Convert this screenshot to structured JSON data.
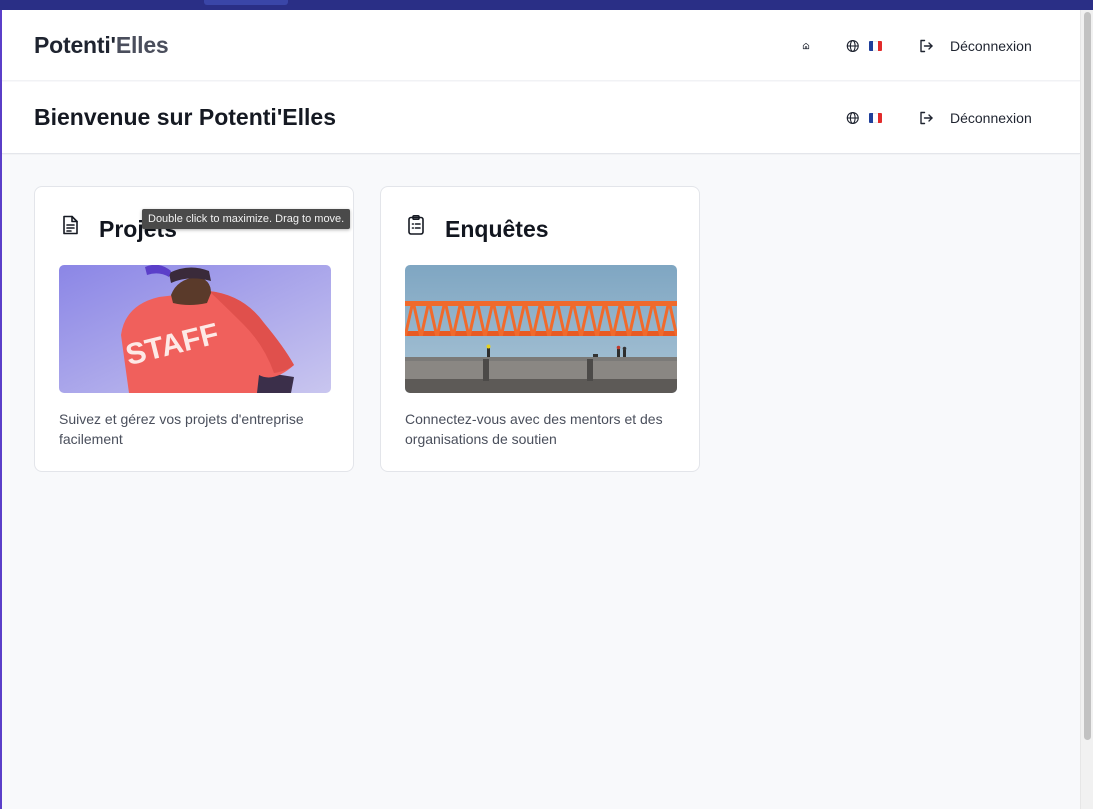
{
  "app": {
    "brand_part1": "Potenti'",
    "brand_part2": "Elles"
  },
  "header": {
    "home_icon": "home-icon",
    "language_icon": "globe-icon",
    "language_flag": "flag-fr",
    "logout_icon": "logout-icon",
    "logout_label": "Déconnexion"
  },
  "page": {
    "title": "Bienvenue sur Potenti'Elles",
    "language_icon": "globe-icon",
    "language_flag": "flag-fr",
    "logout_label": "Déconnexion"
  },
  "cards": [
    {
      "title": "Projets",
      "icon": "document-icon",
      "image": "person wearing red STAFF shirt",
      "image_text": "STAFF",
      "description": "Suivez et gérez vos projets d'entreprise facilement"
    },
    {
      "title": "Enquêtes",
      "icon": "clipboard-list-icon",
      "image": "orange steel truss bridge construction",
      "description": "Connectez-vous avec des mentors et des organisations de soutien"
    }
  ],
  "tooltip": {
    "text": "Double click to maximize. Drag to move."
  },
  "colors": {
    "flag_blue": "#1f3f9a",
    "flag_white": "#ffffff",
    "flag_red": "#e22b2b",
    "title_text": "#151922",
    "body_text": "#4a4f5c"
  }
}
